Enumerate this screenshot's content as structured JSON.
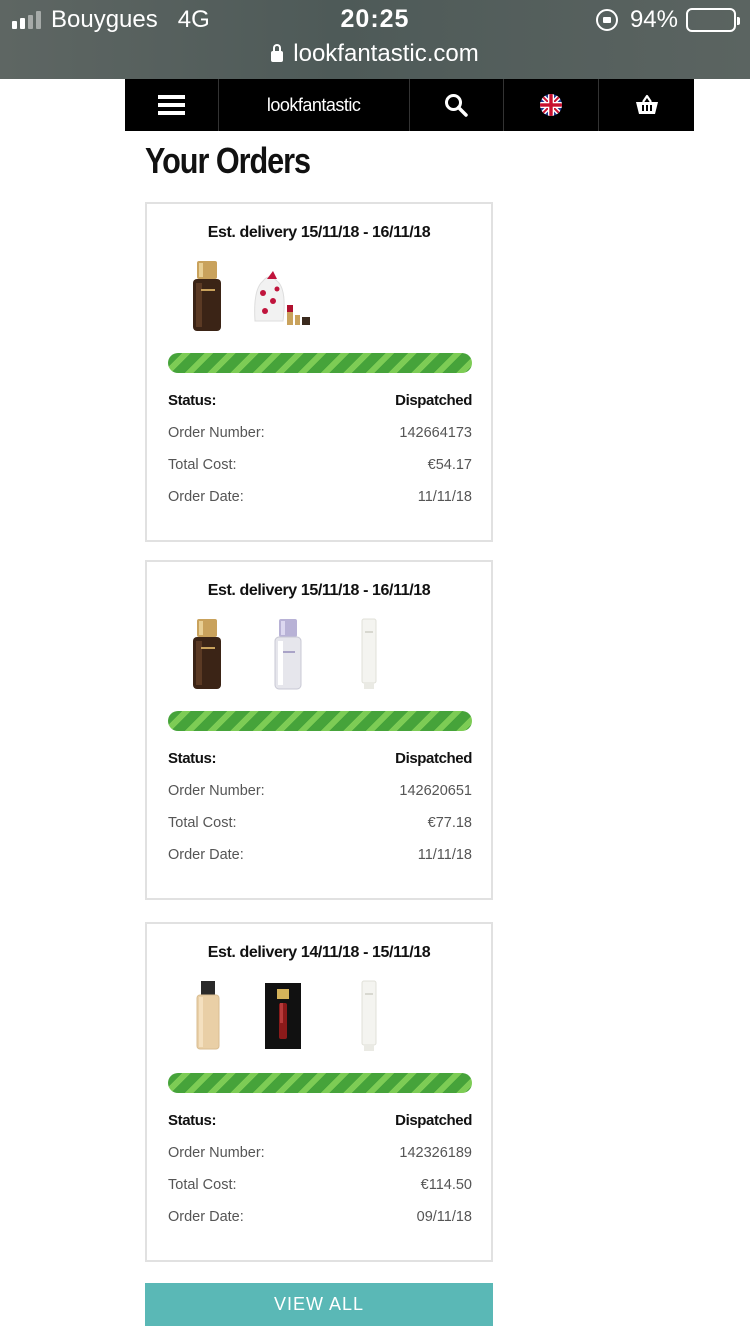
{
  "status_bar": {
    "carrier": "Bouygues",
    "network": "4G",
    "time": "20:25",
    "battery_percent": "94%",
    "battery_level": 0.94
  },
  "browser": {
    "url": "lookfantastic.com"
  },
  "site_header": {
    "logo": "lookfantastic",
    "menu_icon": "hamburger-menu-icon",
    "search_icon": "search-icon",
    "flag_icon": "uk-flag-icon",
    "basket_icon": "basket-icon"
  },
  "page": {
    "title": "Your Orders"
  },
  "orders": [
    {
      "delivery": "Est. delivery 15/11/18 - 16/11/18",
      "progress": 1.0,
      "products": [
        "serum-bottle",
        "gift-bag-lipstick"
      ],
      "status_label": "Status:",
      "status": "Dispatched",
      "order_number_label": "Order Number:",
      "order_number": "142664173",
      "total_label": "Total Cost:",
      "total": "€54.17",
      "date_label": "Order Date:",
      "date": "11/11/18"
    },
    {
      "delivery": "Est. delivery 15/11/18 - 16/11/18",
      "progress": 1.0,
      "products": [
        "serum-bottle",
        "white-serum-bottle",
        "cream-tube"
      ],
      "status_label": "Status:",
      "status": "Dispatched",
      "order_number_label": "Order Number:",
      "order_number": "142620651",
      "total_label": "Total Cost:",
      "total": "€77.18",
      "date_label": "Order Date:",
      "date": "11/11/18"
    },
    {
      "delivery": "Est. delivery 14/11/18 - 15/11/18",
      "progress": 1.0,
      "products": [
        "foundation-bottle",
        "lip-gloss-box",
        "cream-tube"
      ],
      "status_label": "Status:",
      "status": "Dispatched",
      "order_number_label": "Order Number:",
      "order_number": "142326189",
      "total_label": "Total Cost:",
      "total": "€114.50",
      "date_label": "Order Date:",
      "date": "09/11/18"
    }
  ],
  "view_all_label": "VIEW ALL",
  "colors": {
    "progress_green": "#46a33a",
    "progress_light": "#7dcc55",
    "button_teal": "#5ab8b6",
    "header_black": "#000000"
  }
}
